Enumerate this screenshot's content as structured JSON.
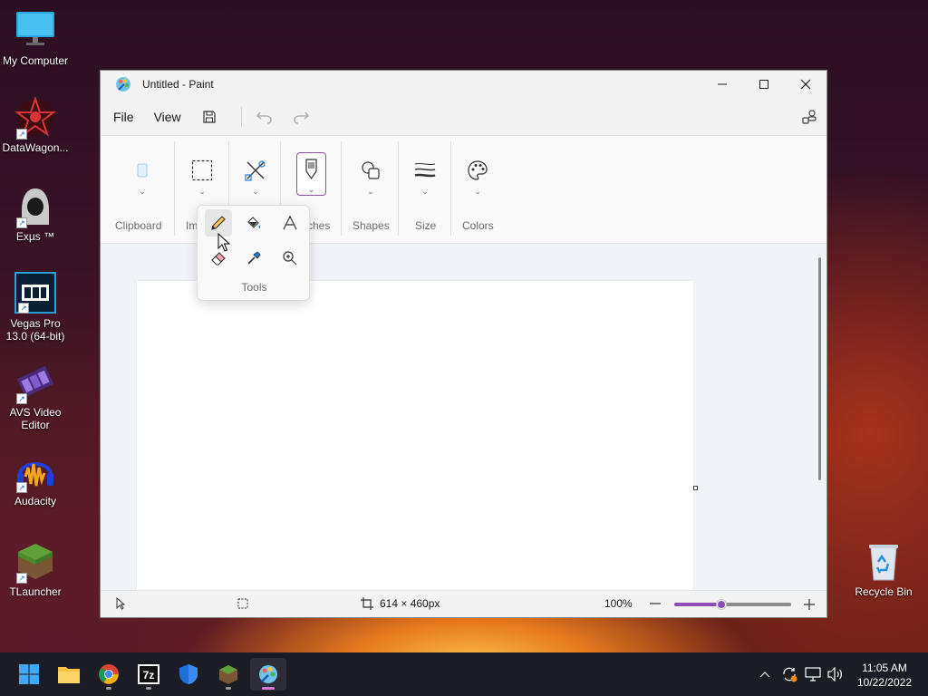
{
  "desktop": {
    "icons": [
      {
        "label": "My Computer"
      },
      {
        "label": "DataWagon..."
      },
      {
        "label": "Exµs ™"
      },
      {
        "label": "Vegas Pro 13.0 (64-bit)"
      },
      {
        "label": "AVS Video Editor"
      },
      {
        "label": "Audacity"
      },
      {
        "label": "TLauncher"
      },
      {
        "label": "Recycle Bin"
      }
    ]
  },
  "window": {
    "title": "Untitled - Paint",
    "menu": {
      "file": "File",
      "view": "View"
    },
    "ribbon": {
      "groups": {
        "clipboard": "Clipboard",
        "image_partial": "Im",
        "brushes_partial": "ches",
        "shapes": "Shapes",
        "size": "Size",
        "colors": "Colors"
      }
    },
    "tools_flyout": {
      "label": "Tools",
      "tools": [
        "pencil",
        "fill",
        "text",
        "eraser",
        "color-picker",
        "magnifier"
      ],
      "selected": "pencil"
    },
    "status": {
      "canvas_size": "614 × 460px",
      "zoom": "100%",
      "zoom_level": 0.4
    }
  },
  "taskbar": {
    "apps": [
      "start",
      "file-explorer",
      "chrome",
      "7zip",
      "windows-security",
      "tlauncher",
      "paint"
    ],
    "active_app": "paint",
    "clock": {
      "time": "11:05 AM",
      "date": "10/22/2022"
    }
  },
  "colors": {
    "accent": "#8e4fb5",
    "taskbar": "#1c1c24"
  }
}
